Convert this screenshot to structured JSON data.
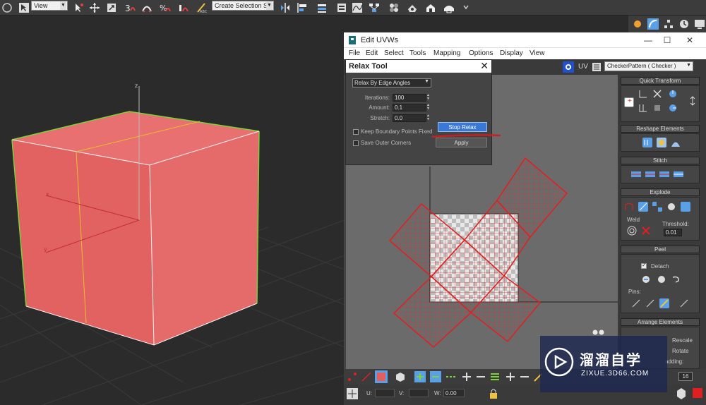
{
  "main_toolbar": {
    "view_select": "View",
    "selection_set_placeholder": "Create Selection Se",
    "icons": [
      "undo-icon",
      "select-object-icon",
      "select-by-name-icon",
      "move-icon",
      "rotate-icon",
      "scale-icon",
      "snap-3d-icon",
      "angle-snap-icon",
      "percent-snap-icon",
      "spinner-snap-icon",
      "edit-named-selection-icon",
      "mirror-icon",
      "align-icon",
      "layer-manager-icon",
      "curve-editor-icon",
      "schematic-view-icon",
      "material-editor-icon",
      "render-setup-icon",
      "render-frame-icon",
      "render-icon"
    ],
    "accent": "#5aa0e8"
  },
  "viewport": {
    "axis_z": "z",
    "axis_x": "x",
    "axis_y": "y",
    "cube_color": "#e06060",
    "edge_color": "#7dd13a"
  },
  "uvw_window": {
    "title": "Edit UVWs",
    "controls": {
      "minimize": "—",
      "maximize": "☐",
      "close": "✕"
    },
    "menu": [
      "File",
      "Edit",
      "Select",
      "Tools",
      "Mapping",
      "Options",
      "Display",
      "View"
    ],
    "uv_label": "UV",
    "checker_select": "CheckerPattern  ( Checker )"
  },
  "relax_tool": {
    "title": "Relax Tool",
    "close": "✕",
    "method": "Relax By Edge Angles",
    "iterations_label": "Iterations:",
    "iterations_value": "100",
    "amount_label": "Amount:",
    "amount_value": "0.1",
    "stretch_label": "Stretch:",
    "stretch_value": "0.0",
    "keep_boundary_label": "Keep Boundary Points Fixed",
    "save_outer_label": "Save Outer Corners",
    "stop_relax_label": "Stop Relax",
    "apply_label": "Apply"
  },
  "rollouts": {
    "quick_transform": "Quick Transform",
    "reshape_elements": "Reshape Elements",
    "stitch": "Stitch",
    "explode": "Explode",
    "weld": "Weld",
    "threshold_label": "Threshold:",
    "threshold_value": "0.01",
    "peel": "Peel",
    "detach": "Detach",
    "pins": "Pins:",
    "arrange_elements": "Arrange Elements",
    "rescale": "Rescale",
    "rotate": "Rotate",
    "padding": "adding:"
  },
  "bottom_bar": {
    "u_label": "U:",
    "v_label": "V:",
    "w_label": "W:",
    "w_value": "0.00",
    "spinner_value": "16"
  },
  "watermark": {
    "cn": "溜溜自学",
    "url": "ZIXUE.3D66.COM"
  }
}
